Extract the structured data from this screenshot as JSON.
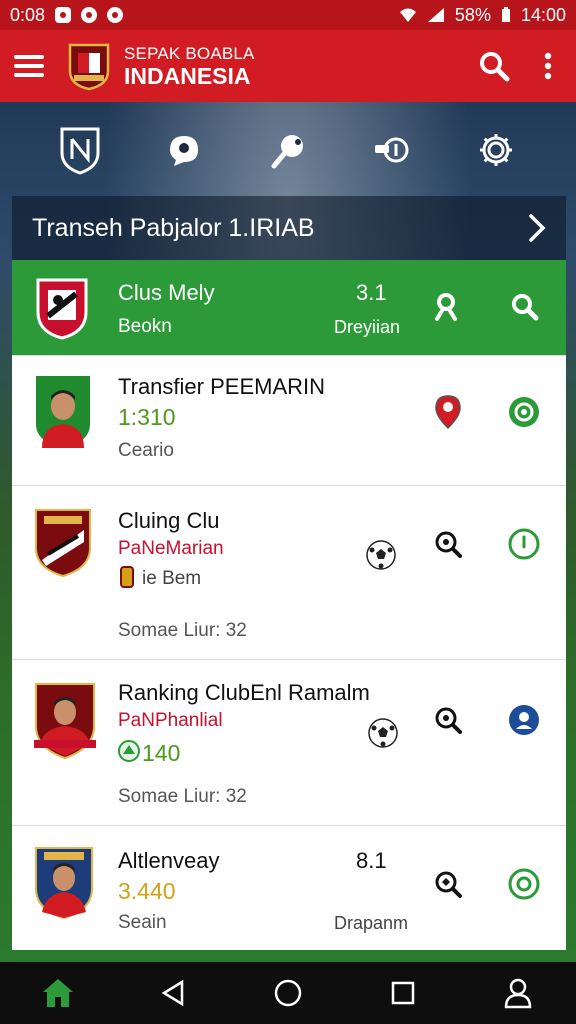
{
  "status_bar": {
    "time_left": "0:08",
    "battery": "58%",
    "time_right": "14:00"
  },
  "app_bar": {
    "title_line1": "SEPAK BOABLA",
    "title_line2": "INDANESIA"
  },
  "quick_icons": [
    "crest-icon",
    "chat-ball-icon",
    "ping-pong-icon",
    "whistle-icon",
    "gear-icon"
  ],
  "banner": {
    "text": "Transeh Pabjalor 1.IRIAB"
  },
  "rows": [
    {
      "name": "Clus Mely",
      "sub": "Beokn",
      "score": "3.1",
      "right_label": "Dreyiian"
    },
    {
      "name": "Transfier PEEMARIN",
      "sub": "1:310",
      "line3": "Ceario"
    },
    {
      "name": "Cluing Clu",
      "sub": "PaNeMarian",
      "line3": "ie Bem",
      "foot": "Somae Liur: 32"
    },
    {
      "name": "Ranking ClubEnl Ramalm",
      "sub": "PaNPhanlial",
      "line3": "140",
      "foot": "Somae Liur: 32"
    },
    {
      "name": "Altlenveay",
      "sub": "3.440",
      "line3": "Seain",
      "score": "8.1",
      "right_label": "Drapanm"
    }
  ],
  "colors": {
    "primary_red": "#d01c22",
    "status_red": "#b8141b",
    "highlight_green": "#2c9a38",
    "score_green": "#4a9a1e",
    "accent_red": "#c8102e",
    "gold": "#d4a017",
    "nav_black": "#0e0e0e"
  }
}
